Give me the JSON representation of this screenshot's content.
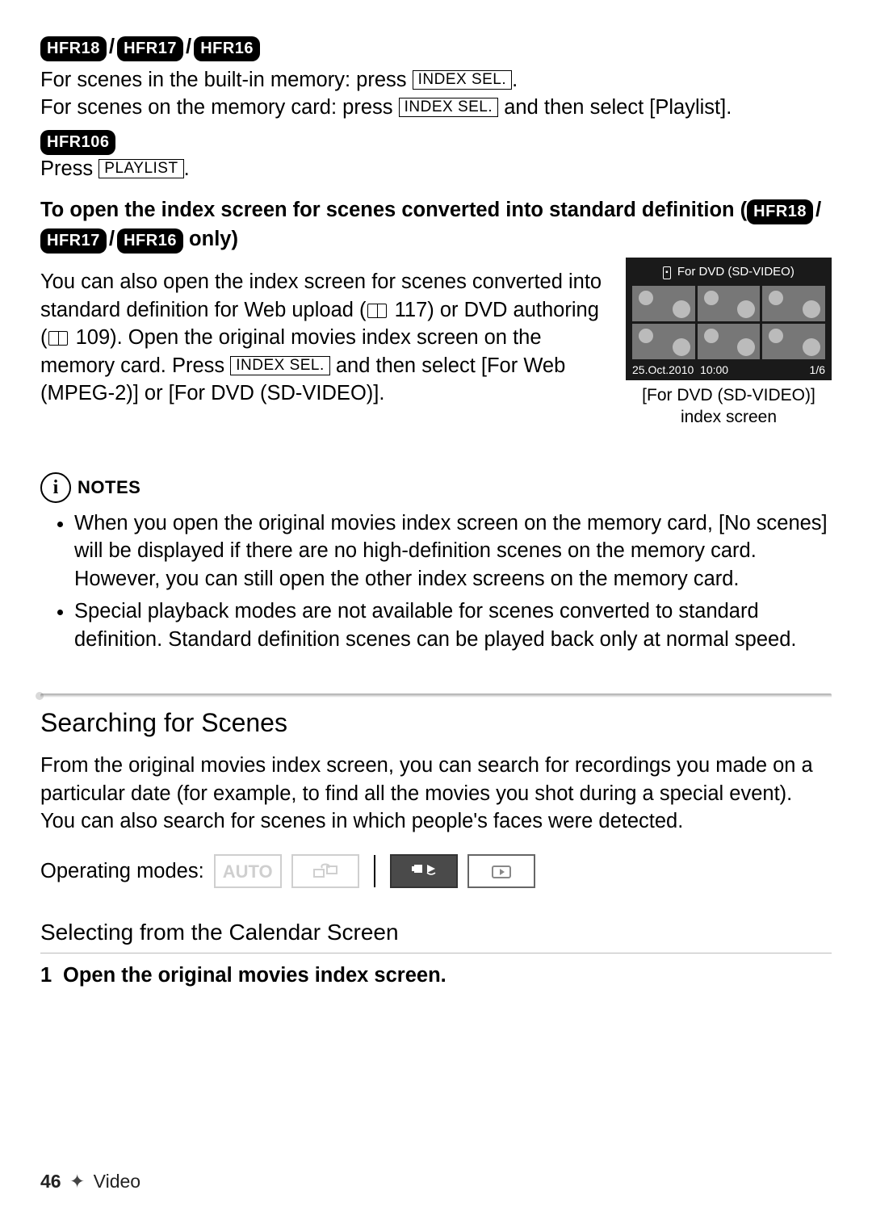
{
  "models_line1": {
    "m1": "HFR18",
    "m2": "HFR17",
    "m3": "HFR16"
  },
  "para1a": "For scenes in the built-in memory: press ",
  "btn_indexsel": "INDEX SEL.",
  "para1b": ".",
  "para2a": "For scenes on the memory card: press ",
  "para2b": " and then select [Playlist].",
  "model_single": "HFR106",
  "para3a": "Press ",
  "btn_playlist": "PLAYLIST",
  "para3b": ".",
  "h2a": "To open the index screen for scenes converted into standard definition (",
  "h2_models": {
    "m1": "HFR18",
    "m2": "HFR17",
    "m3": "HFR16"
  },
  "h2b": " only)",
  "para4a": "You can also open the index screen for scenes converted into standard definition for Web upload (",
  "para4_ref1": " 117",
  "para4b": ") or DVD authoring (",
  "para4_ref2": " 109",
  "para4c": "). Open the original movies index screen on the memory card. Press ",
  "para4d": " and then select [For Web (MPEG-2)] or [For DVD (SD-VIDEO)].",
  "figure": {
    "screen_title": "For DVD (SD-VIDEO)",
    "date": "25.Oct.2010",
    "time": "10:00",
    "counter": "1/6",
    "caption1": "[For DVD (SD-VIDEO)]",
    "caption2": "index screen"
  },
  "notes_label": "NOTES",
  "notes": [
    "When you open the original movies index screen on the memory card, [No scenes] will be displayed if there are no high-definition scenes on the memory card. However, you can still open the other index screens on the memory card.",
    "Special playback modes are not available for scenes converted to standard definition. Standard definition scenes can be played back only at normal speed."
  ],
  "section_title": "Searching for Scenes",
  "section_para": "From the original movies index screen, you can search for recordings you made on a particular date (for example, to find all the movies you shot during a special event). You can also search for scenes in which people's faces were detected.",
  "op_modes_label": "Operating modes:",
  "modes": {
    "auto": "AUTO"
  },
  "subheading": "Selecting from the Calendar Screen",
  "step1_num": "1",
  "step1_text": "Open the original movies index screen.",
  "page_number": "46",
  "page_section": "Video"
}
